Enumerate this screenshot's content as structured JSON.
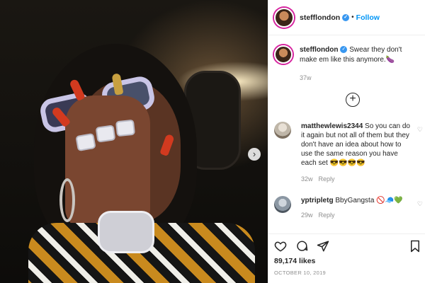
{
  "post": {
    "username": "stefflondon",
    "follow_label": "Follow",
    "caption_text": "Swear they don't make em like this anymore.",
    "caption_emoji": "🍆",
    "caption_time": "37w",
    "likes": "89,174 likes",
    "date": "OCTOBER 10, 2019"
  },
  "comments": [
    {
      "username": "matthewlewis2344",
      "text": "So you can do it again but not all of them but they don't have an idea about how to use the same reason you have each set",
      "emoji": "😎😎😎😎",
      "time": "32w",
      "reply_label": "Reply"
    },
    {
      "username": "yptripletg",
      "text": "BbyGangsta",
      "emoji": "🚫🧢💚",
      "time": "29w",
      "reply_label": "Reply"
    }
  ],
  "icons": {
    "verified": "verified-badge-icon",
    "next": "chevron-right-icon",
    "load_more": "plus-circle-icon",
    "like": "heart-icon",
    "comment": "comment-bubble-icon",
    "share": "paper-plane-icon",
    "save": "bookmark-icon"
  },
  "colors": {
    "link_blue": "#0095f6",
    "verified_blue": "#3897f0",
    "muted_gray": "#8e8e8e"
  }
}
